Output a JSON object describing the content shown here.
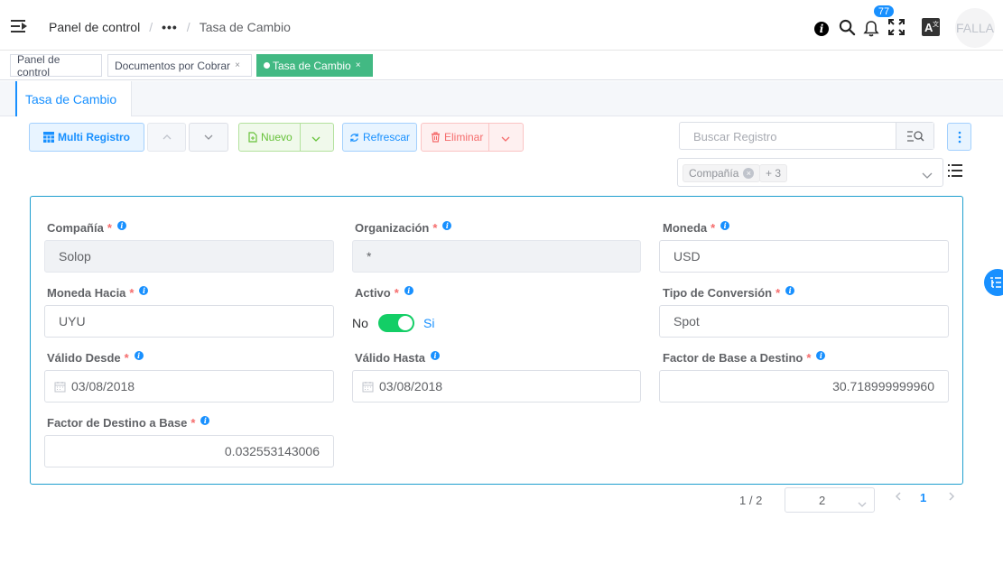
{
  "header": {
    "breadcrumb": {
      "home": "Panel de control",
      "ellipsis": "•••",
      "current": "Tasa de Cambio"
    },
    "notification_count": "77",
    "avatar_text": "FALLA"
  },
  "tags": {
    "items": [
      {
        "label": "Panel de control"
      },
      {
        "label": "Documentos por Cobrar",
        "close": "×"
      },
      {
        "label": "Tasa de Cambio",
        "close": "×"
      }
    ]
  },
  "tabs": {
    "active_label": "Tasa de Cambio"
  },
  "toolbar": {
    "multi_label": "Multi Registro",
    "new_label": "Nuevo",
    "refresh_label": "Refrescar",
    "delete_label": "Eliminar",
    "search_placeholder": "Buscar Registro",
    "filter_chip": "Compañía",
    "filter_more": "+ 3"
  },
  "form": {
    "required_mark": "*",
    "company": {
      "label": "Compañía",
      "value": "Solop"
    },
    "organization": {
      "label": "Organización",
      "value": "*"
    },
    "currency": {
      "label": "Moneda",
      "value": "USD"
    },
    "currency_to": {
      "label": "Moneda Hacia",
      "value": "UYU"
    },
    "active": {
      "label": "Activo",
      "off_label": "No",
      "on_label": "Si",
      "value": true
    },
    "conversion_type": {
      "label": "Tipo de Conversión",
      "value": "Spot"
    },
    "valid_from": {
      "label": "Válido Desde",
      "value": "03/08/2018"
    },
    "valid_to": {
      "label": "Válido Hasta",
      "value": "03/08/2018"
    },
    "multiply_rate": {
      "label": "Factor de Base a Destino",
      "value": "30.718999999960"
    },
    "divide_rate": {
      "label": "Factor de Destino a Base",
      "value": "0.032553143006"
    }
  },
  "pagination": {
    "count": "1 / 2",
    "page_size": "2",
    "current_page": "1"
  },
  "colors": {
    "primary": "#1890ff",
    "success": "#13ce66",
    "tag_active": "#42b983",
    "danger": "#f56c6c"
  }
}
